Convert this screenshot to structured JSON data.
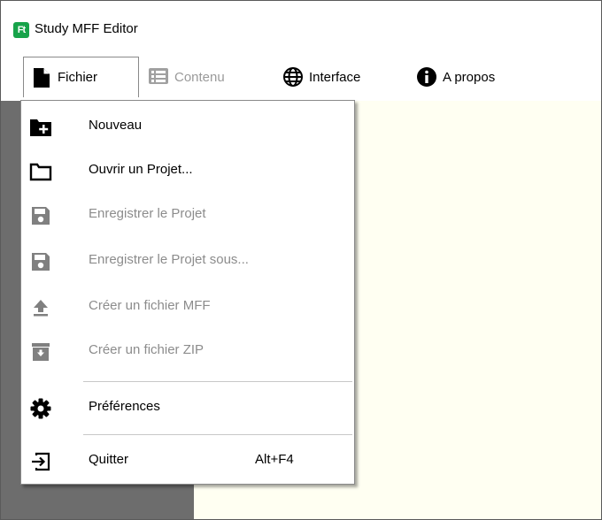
{
  "window": {
    "title": "Study MFF Editor",
    "app_icon_text": "Ft"
  },
  "menubar": {
    "items": [
      {
        "label": "Fichier",
        "icon": "file-icon",
        "state": "open"
      },
      {
        "label": "Contenu",
        "icon": "list-icon",
        "state": "disabled"
      },
      {
        "label": "Interface",
        "icon": "globe-icon",
        "state": "normal"
      },
      {
        "label": "A propos",
        "icon": "info-icon",
        "state": "normal"
      }
    ]
  },
  "file_menu": {
    "items": [
      {
        "label": "Nouveau",
        "icon": "new-folder-icon",
        "enabled": true
      },
      {
        "label": "Ouvrir un Projet...",
        "icon": "folder-open-icon",
        "enabled": true
      },
      {
        "label": "Enregistrer le Projet",
        "icon": "save-icon",
        "enabled": false
      },
      {
        "label": "Enregistrer le Projet sous...",
        "icon": "save-as-icon",
        "enabled": false
      },
      {
        "label": "Créer un fichier MFF",
        "icon": "upload-icon",
        "enabled": false
      },
      {
        "label": "Créer un fichier ZIP",
        "icon": "archive-icon",
        "enabled": false
      },
      {
        "label": "Préférences",
        "icon": "gear-icon",
        "enabled": true
      },
      {
        "label": "Quitter",
        "icon": "exit-icon",
        "enabled": true,
        "shortcut": "Alt+F4"
      }
    ]
  },
  "colors": {
    "accent": "#17a34a",
    "left_panel": "#6d6d6d",
    "content_bg": "#fffff2",
    "disabled_text": "#8c8c8c"
  }
}
